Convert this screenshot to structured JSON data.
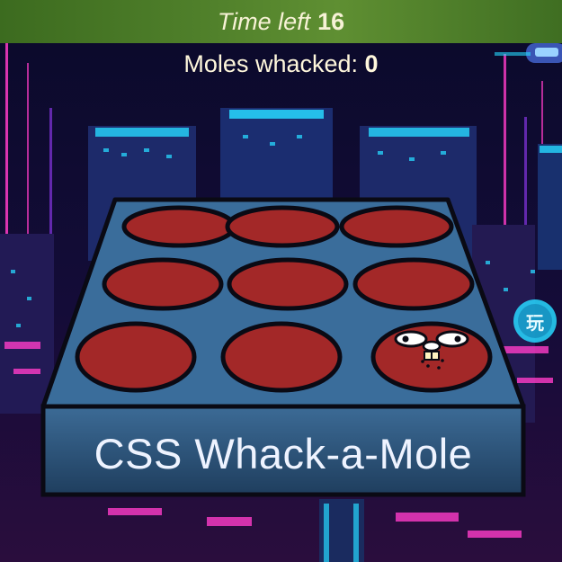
{
  "timer": {
    "label": "Time left",
    "value": "16"
  },
  "score": {
    "label": "Moles whacked:",
    "value": "0"
  },
  "game": {
    "title": "CSS Whack-a-Mole",
    "holes": [
      {
        "mole": false
      },
      {
        "mole": false
      },
      {
        "mole": false
      },
      {
        "mole": false
      },
      {
        "mole": false
      },
      {
        "mole": false
      },
      {
        "mole": false
      },
      {
        "mole": false
      },
      {
        "mole": true
      }
    ]
  },
  "background": {
    "sign_glyph": "玩"
  },
  "colors": {
    "board_top": "#3a6d9b",
    "hole": "#a32828",
    "timer_bar": "#4a7a28",
    "neon_pink": "#ff3cc8",
    "neon_cyan": "#27d8ff"
  }
}
